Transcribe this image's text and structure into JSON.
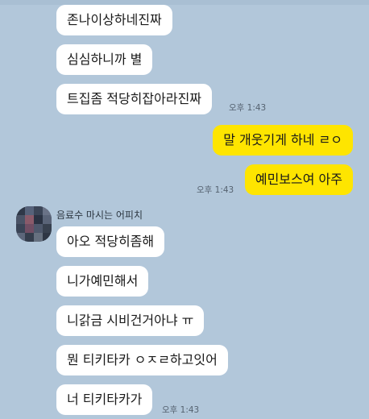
{
  "chat": {
    "messages": [
      {
        "text": "존나이상하네진짜"
      },
      {
        "text": "심심하니까 별"
      },
      {
        "text": "트집좀 적당히잡아라진짜"
      },
      {
        "text": "말 개웃기게 하네 ㄹㅇ"
      },
      {
        "text": "예민보스여 아주"
      },
      {
        "text": "아오 적당히좀해"
      },
      {
        "text": "니가예민해서"
      },
      {
        "text": "니갉금 시비건거아냐 ㅠ"
      },
      {
        "text": "뭔 티키타카 ㅇㅈㄹ하고잇어"
      },
      {
        "text": "너 티키타카가"
      }
    ],
    "timestamps": [
      "오후 1:43",
      "오후 1:43",
      "오후 1:43"
    ],
    "sender_name": "음료수 마시는 어피치",
    "colors": {
      "background": "#b2c7da",
      "incoming_bubble": "#ffffff",
      "outgoing_bubble": "#fee500"
    }
  }
}
